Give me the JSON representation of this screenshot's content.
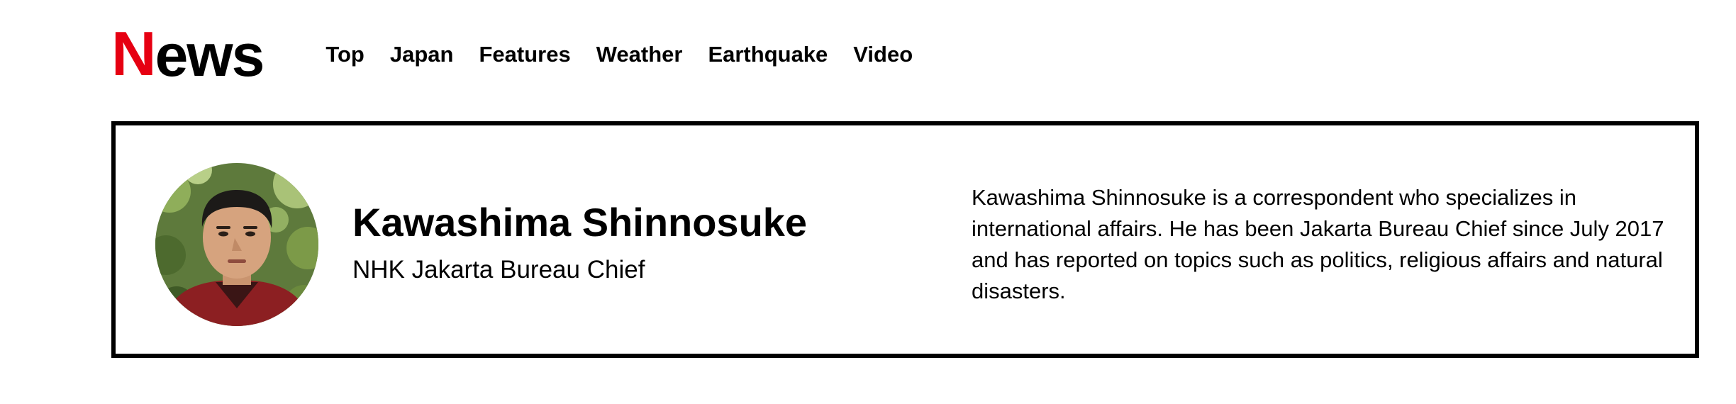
{
  "header": {
    "logo": {
      "initial": "N",
      "rest": "ews"
    },
    "nav": [
      {
        "label": "Top"
      },
      {
        "label": "Japan"
      },
      {
        "label": "Features"
      },
      {
        "label": "Weather"
      },
      {
        "label": "Earthquake"
      },
      {
        "label": "Video"
      }
    ]
  },
  "colors": {
    "brand_red": "#e60012",
    "text": "#000000",
    "border": "#000000",
    "background": "#ffffff"
  },
  "profile": {
    "name": "Kawashima Shinnosuke",
    "title": "NHK Jakarta Bureau Chief",
    "bio": "Kawashima Shinnosuke is a correspondent who specializes in international affairs. He has been Jakarta Bureau Chief since July 2017 and has reported on topics such as politics, religious affairs and natural disasters."
  }
}
